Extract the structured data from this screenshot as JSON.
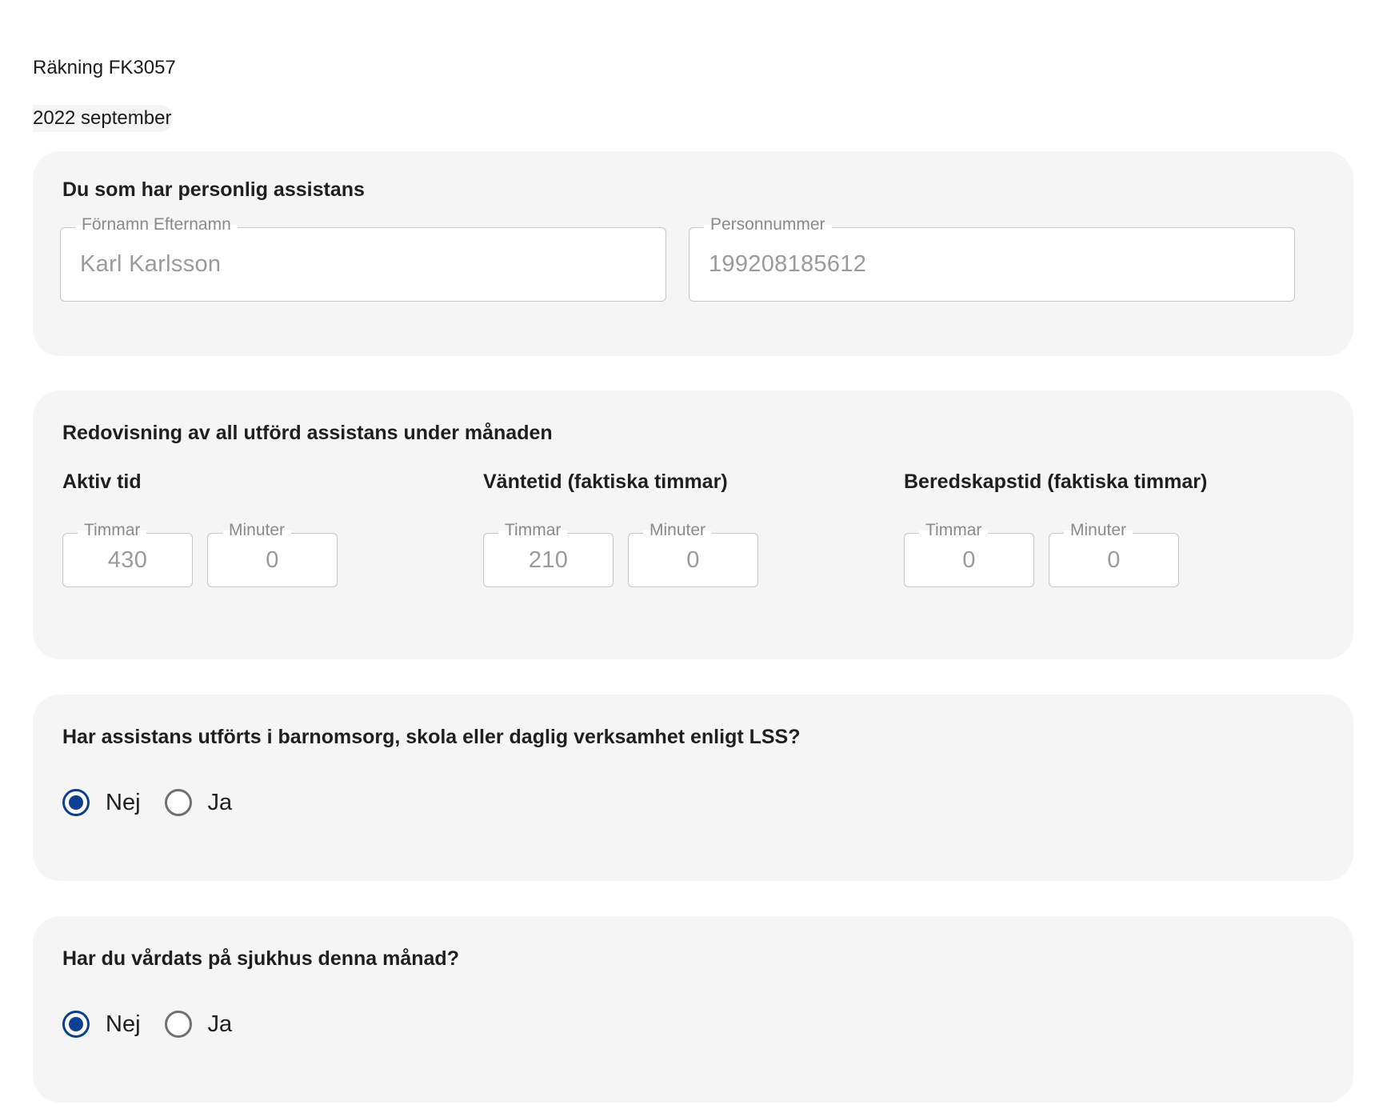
{
  "header": {
    "title": "Räkning FK3057",
    "period": "2022 september"
  },
  "personal_section": {
    "heading": "Du som har personlig assistans",
    "name_field": {
      "label": "Förnamn Efternamn",
      "value": "Karl Karlsson"
    },
    "pnr_field": {
      "label": "Personnummer",
      "value": "199208185612"
    }
  },
  "assistance_section": {
    "heading": "Redovisning av all utförd assistans under månaden",
    "groups": [
      {
        "title": "Aktiv tid",
        "hours_label": "Timmar",
        "hours": "430",
        "minutes_label": "Minuter",
        "minutes": "0"
      },
      {
        "title": "Väntetid (faktiska timmar)",
        "hours_label": "Timmar",
        "hours": "210",
        "minutes_label": "Minuter",
        "minutes": "0"
      },
      {
        "title": "Beredskapstid (faktiska timmar)",
        "hours_label": "Timmar",
        "hours": "0",
        "minutes_label": "Minuter",
        "minutes": "0"
      }
    ]
  },
  "childcare_question": {
    "heading": "Har assistans utförts i barnomsorg, skola eller daglig verksamhet enligt LSS?",
    "options": [
      {
        "label": "Nej",
        "selected": true
      },
      {
        "label": "Ja",
        "selected": false
      }
    ]
  },
  "hospital_question": {
    "heading": "Har du vårdats på sjukhus denna månad?",
    "options": [
      {
        "label": "Nej",
        "selected": true
      },
      {
        "label": "Ja",
        "selected": false
      }
    ]
  },
  "colors": {
    "card_background": "#f5f5f5",
    "radio_selected": "#0b3f8f",
    "field_border": "#c6c6c6",
    "muted_text": "#8a8a8a"
  }
}
